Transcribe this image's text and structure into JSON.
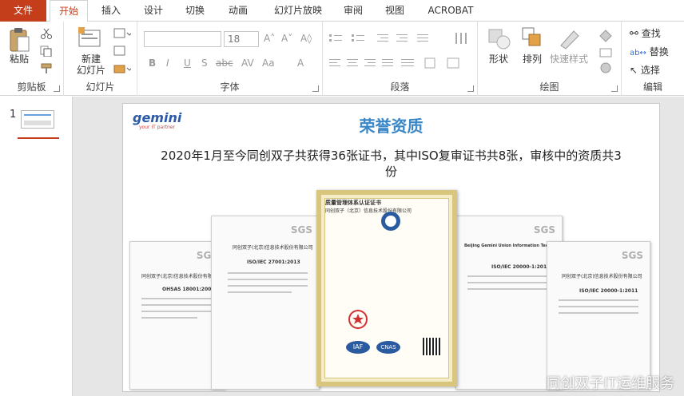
{
  "tabs": [
    "文件",
    "开始",
    "插入",
    "设计",
    "切换",
    "动画",
    "幻灯片放映",
    "审阅",
    "视图",
    "ACROBAT"
  ],
  "ribbon": {
    "clipboard": {
      "paste": "粘贴",
      "label": "剪贴板"
    },
    "slides": {
      "new_slide_line1": "新建",
      "new_slide_line2": "幻灯片",
      "label": "幻灯片"
    },
    "font": {
      "font_size": "18",
      "label": "字体"
    },
    "paragraph": {
      "label": "段落"
    },
    "drawing": {
      "shapes": "形状",
      "arrange": "排列",
      "quick_styles": "快速样式",
      "label": "绘图"
    },
    "editing": {
      "find": "查找",
      "replace": "替换",
      "select": "选择",
      "label": "编辑"
    }
  },
  "thumbnails": {
    "number": "1"
  },
  "slide": {
    "logo": "gemini",
    "logo_tagline": "your IT partner",
    "title": "荣誉资质",
    "subtitle": "2020年1月至今同创双子共获得36张证书，其中ISO复审证书共8张，审核中的资质共3份",
    "certificates": [
      {
        "company": "同创双子(北京)信息技术股份有限公司",
        "standard": "OHSAS 18001:2007"
      },
      {
        "company": "同创双子(北京)信息技术股份有限公司",
        "standard": "ISO/IEC 27001:2013"
      },
      {
        "title": "质量管理体系认证证书",
        "company": "同创双子（北京）信息技术股份有限公司",
        "iaf": "IAF",
        "cnas": "CNAS"
      },
      {
        "company": "Beijing Gemini Union Information Technology Co., Ltd.",
        "standard": "ISO/IEC 20000-1:2011"
      },
      {
        "company": "同创双子(北京)信息技术股份有限公司",
        "standard": "ISO/IEC 20000-1:2011"
      }
    ],
    "sgs": "SGS"
  },
  "watermark": "同创双子IT运维服务",
  "colors": {
    "accent": "#c43e1c",
    "title": "#3a87c8"
  }
}
